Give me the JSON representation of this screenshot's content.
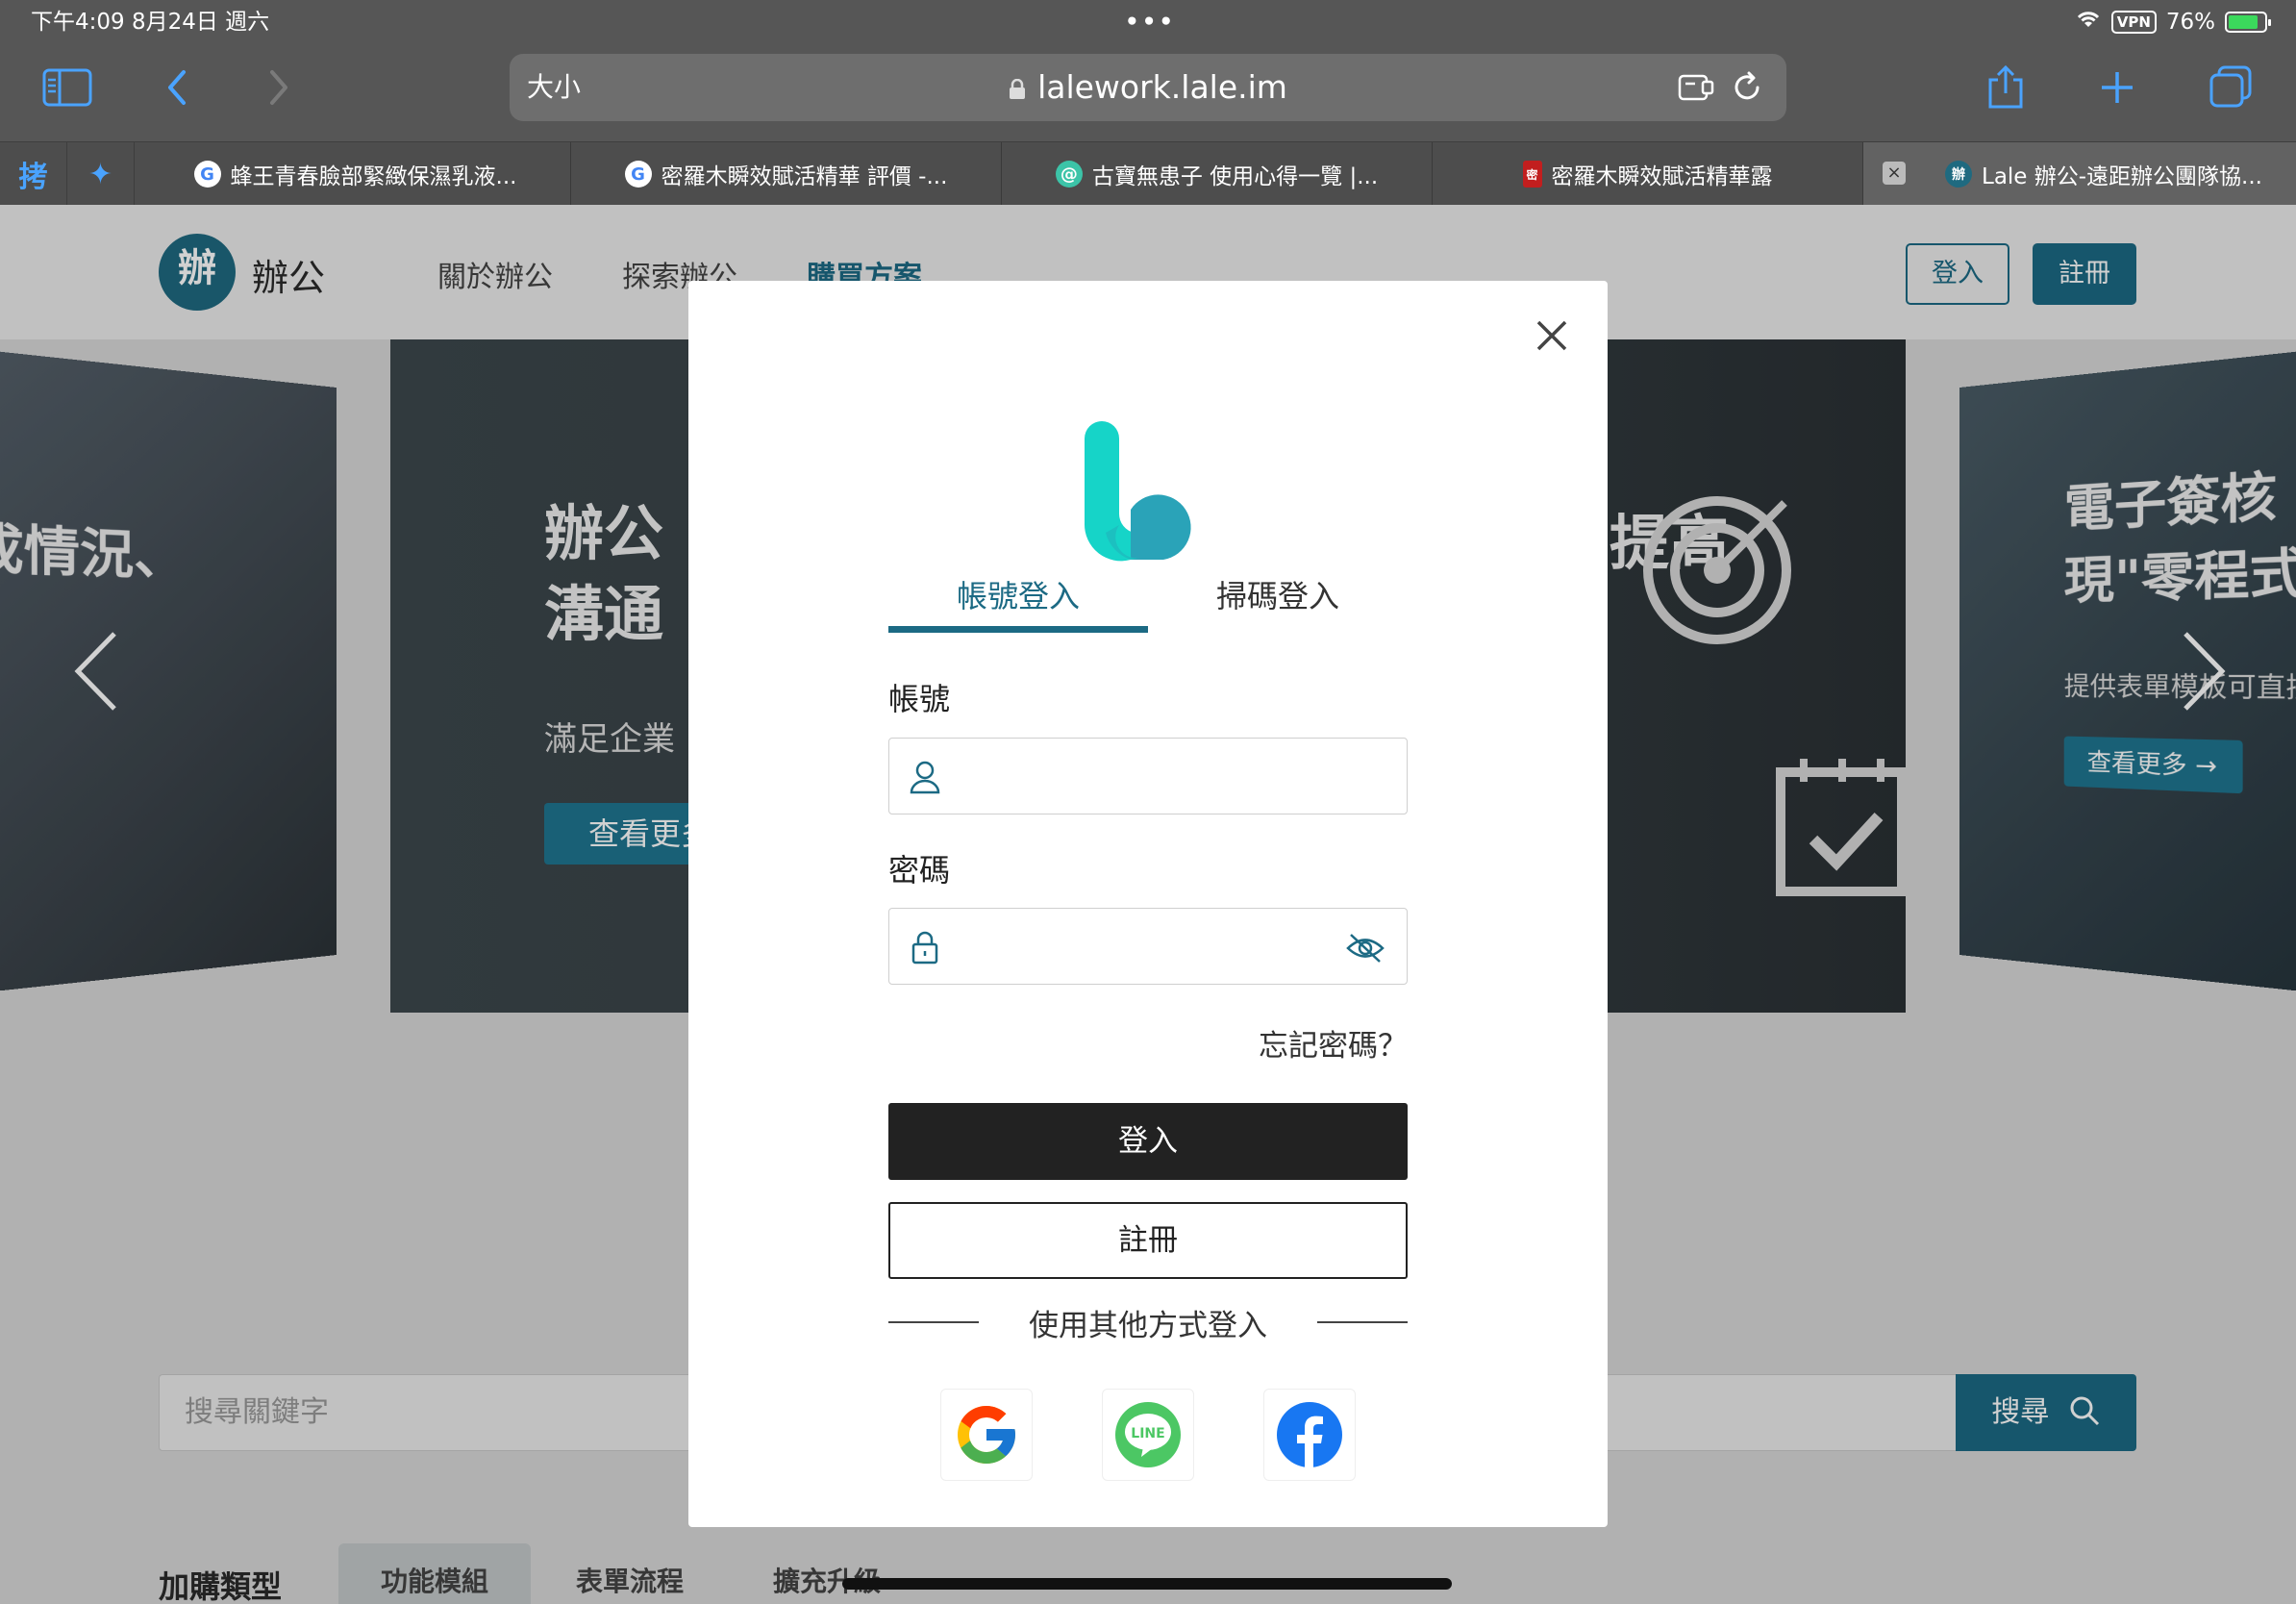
{
  "status_bar": {
    "time_date": "下午4:09   8月24日 週六",
    "dots": "•••",
    "vpn": "VPN",
    "battery": "76%"
  },
  "toolbar": {
    "text_size": "大小",
    "url": "lalework.lale.im"
  },
  "tabs": {
    "pinned": [
      "拷",
      "✦"
    ],
    "items": [
      {
        "label": "蜂王青春臉部緊緻保濕乳液...",
        "favicon": "G"
      },
      {
        "label": "密羅木瞬效賦活精華 評價 -...",
        "favicon": "G"
      },
      {
        "label": "古寶無患子 使用心得一覽 |...",
        "favicon": "@"
      },
      {
        "label": "密羅木瞬效賦活精華露",
        "favicon": "密"
      },
      {
        "label": "Lale 辦公-遠距辦公團隊協...",
        "favicon": "辦"
      }
    ]
  },
  "site": {
    "logo_char": "辦",
    "logo_text": "辦公",
    "nav": [
      "關於辦公",
      "探索辦公",
      "購買方案"
    ],
    "login": "登入",
    "register": "註冊",
    "slides": {
      "left_title": "成情況、",
      "main_title_1": "辦公",
      "main_title_2": "溝通",
      "main_sub": "滿足企業",
      "main_btn": "查看更多",
      "main_right_title": "提高",
      "right_title_1": "電子簽核",
      "right_title_2": "現\"零程式",
      "right_sub": "提供表單模板可直接",
      "right_btn": "查看更多 →"
    },
    "search_placeholder": "搜尋關鍵字",
    "search_button": "搜尋",
    "addon_label": "加購類型",
    "addon_tabs": [
      "功能模組",
      "表單流程",
      "擴充升級"
    ]
  },
  "modal": {
    "tabs": [
      "帳號登入",
      "掃碼登入"
    ],
    "account_label": "帳號",
    "password_label": "密碼",
    "forgot": "忘記密碼？",
    "login_button": "登入",
    "register_button": "註冊",
    "other_methods": "使用其他方式登入",
    "social": [
      "google",
      "line",
      "facebook"
    ],
    "line_text": "LINE"
  },
  "colors": {
    "brand": "#1c6a84",
    "logo_teal": "#16d4c8",
    "chrome_bg": "#565656",
    "safari_blue": "#4aa3ff"
  }
}
